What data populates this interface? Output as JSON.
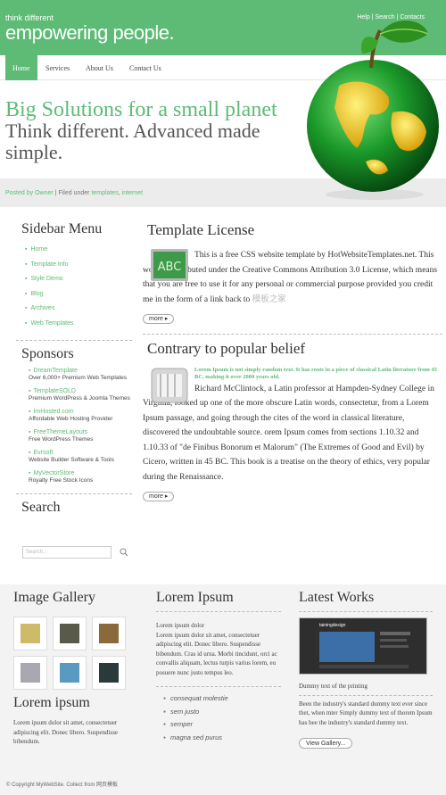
{
  "header": {
    "tagline_small": "think different",
    "tagline_big": "empowering people.",
    "links": [
      "Help",
      "Search",
      "Contacts"
    ],
    "sep": "|"
  },
  "nav": [
    "Home",
    "Services",
    "About Us",
    "Contact Us"
  ],
  "hero": {
    "line1": "Big Solutions for a small planet",
    "line2": "Think different. Advanced made simple."
  },
  "postbar": {
    "posted_prefix": "Posted by",
    "author": "Owner",
    "sep": "|",
    "filed_label": "Filed under",
    "tag1": "templates",
    "comma": ",",
    "tag2": "internet"
  },
  "sidebar": {
    "menu_title": "Sidebar Menu",
    "menu_items": [
      "Home",
      "Template Info",
      "Style Demo",
      "Blog",
      "Archives",
      "Web Templates"
    ],
    "sponsors_title": "Sponsors",
    "sponsors": [
      {
        "name": "DreamTemplate",
        "desc": "Over 6,000+ Premium Web Templates"
      },
      {
        "name": "TemplateSOLD",
        "desc": "Premium WordPress & Joomla Themes"
      },
      {
        "name": "ImHosted.com",
        "desc": "Affordable Web Hosting Provider"
      },
      {
        "name": "FreeThemeLayouts",
        "desc": "Free WordPress Themes"
      },
      {
        "name": "Evrsoft",
        "desc": "Website Builder Software & Tools"
      },
      {
        "name": "MyVectorStore",
        "desc": "Royalty Free Stock Icons"
      }
    ],
    "search_title": "Search",
    "search_placeholder": "Search..."
  },
  "main": {
    "article1": {
      "title": "Template License",
      "icon_text": "ABC",
      "body": "This is a free CSS website template by HotWebsiteTemplates.net. This work is distributed under the Creative Commons Attribution 3.0 License, which means that you are free to use it for any personal or commercial purpose provided you credit me in the form of a link back to",
      "link": "模板之家",
      "more": "more"
    },
    "article2": {
      "title": "Contrary to popular belief",
      "lead": "Lorem Ipsum is not simply random text. It has roots in a piece of classical Latin literature from 45 BC, making it over 2000 years old.",
      "body": "Richard McClintock, a Latin professor at Hampden-Sydney College in Virginia, looked up one of the more obscure Latin words, consectetur, from a Lorem Ipsum passage, and going through the cites of the word in classical literature, discovered the undoubtable source. orem Ipsum comes from sections 1.10.32 and 1.10.33 of \"de Finibus Bonorum et Malorum\" (The Extremes of Good and Evil) by Cicero, written in 45 BC. This book is a treatise on the theory of ethics, very popular during the Renaissance.",
      "more": "more"
    }
  },
  "bottom": {
    "gallery_title": "Image Gallery",
    "lorem_title_left": "Lorem ipsum",
    "lorem_text_left": "Lorem ipsum dolor sit amet, consectetuer adipiscing elit. Donec libero. Suspendisse bibendum.",
    "lorem_title_mid": "Lorem Ipsum",
    "lorem_mid_p1": "Lorem ipsum dolor",
    "lorem_mid_p2": "Lorem ipsum dolor sit amet, consectetuer adipiscing elit. Donec libero. Suspendisse bibendum. Cras id urna. Morbi tincidunt, orci ac convallis aliquam, lectus turpis varius lorem, eu posuere nunc justo tempus leo.",
    "bullets": [
      "consequat molestie",
      "sem justo",
      "semper",
      "magna sed purus"
    ],
    "works_title": "Latest Works",
    "works_caption": "Dummy text of the printing",
    "works_text": "Been the industry's standard dummy text ever since thet, when mter Simply dummy text of thorem Ipsum has bee the industry's standard dummy text.",
    "works_button": "View Gallery...",
    "works_screen_brand": "tainingdesign"
  },
  "footer": {
    "copyright": "© Copyright MyWebSite. Collect from 网页模板"
  },
  "colors": {
    "accent": "#5dbb76"
  }
}
